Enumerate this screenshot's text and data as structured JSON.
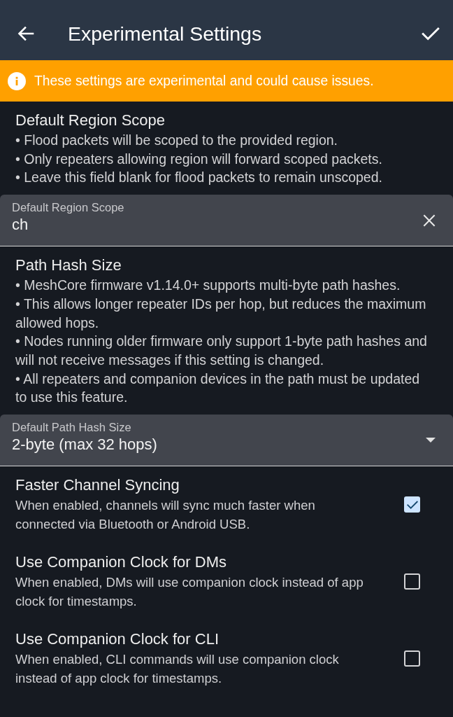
{
  "app_bar": {
    "title": "Experimental Settings"
  },
  "warning_banner": {
    "text": "These settings are experimental and could cause issues."
  },
  "sections": [
    {
      "title": "Default Region Scope",
      "bullets": [
        "• Flood packets will be scoped to the provided region.",
        "• Only repeaters allowing region will forward scoped packets.",
        "• Leave this field blank for flood packets to remain unscoped."
      ],
      "field": {
        "kind": "text",
        "label": "Default Region Scope",
        "value": "ch"
      }
    },
    {
      "title": "Path Hash Size",
      "bullets": [
        "• MeshCore firmware v1.14.0+ supports multi-byte path hashes.",
        "• This allows longer repeater IDs per hop, but reduces the maximum allowed hops.",
        "• Nodes running older firmware only support 1-byte path hashes and will not receive messages if this setting is changed.",
        "• All repeaters and companion devices in the path must be updated to use this feature."
      ],
      "field": {
        "kind": "dropdown",
        "label": "Default Path Hash Size",
        "value": "2-byte (max 32 hops)"
      }
    }
  ],
  "toggles": [
    {
      "title": "Faster Channel Syncing",
      "description": "When enabled, channels will sync much faster when connected via Bluetooth or Android USB.",
      "checked": true
    },
    {
      "title": "Use Companion Clock for DMs",
      "description": "When enabled, DMs will use companion clock instead of app clock for timestamps.",
      "checked": false
    },
    {
      "title": "Use Companion Clock for CLI",
      "description": "When enabled, CLI commands will use companion clock instead of app clock for timestamps.",
      "checked": false
    }
  ]
}
